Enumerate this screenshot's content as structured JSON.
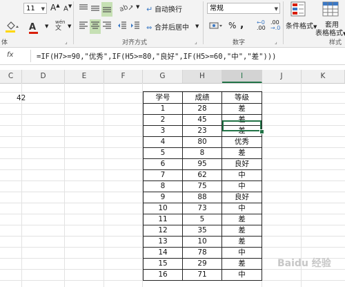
{
  "ribbon": {
    "font_size": "11",
    "font_inc": "A",
    "font_dec": "A",
    "font_color_letter": "A",
    "phonetic": "wén",
    "phonetic_sub": "文",
    "wrap_text": "自动换行",
    "merge_center": "合并后居中",
    "number_format": "常规",
    "percent": "%",
    "comma": ",",
    "dec_inc": ".00",
    "dec_dec": ".00",
    "cond_format": "条件格式",
    "format_as_table_line1": "套用",
    "format_as_table_line2": "表格格式",
    "group_font_partial": "体",
    "group_alignment": "对齐方式",
    "group_number": "数字",
    "group_styles": "样式"
  },
  "formula_bar": {
    "fx": "fx",
    "formula": "=IF(H7>=90,\"优秀\",IF(H5>=80,\"良好\",IF(H5>=60,\"中\",\"差\")))"
  },
  "columns": [
    "C",
    "D",
    "E",
    "F",
    "G",
    "H",
    "I",
    "J",
    "K"
  ],
  "cell_C": "42",
  "table": {
    "headers": [
      "学号",
      "成绩",
      "等级"
    ],
    "rows": [
      [
        "1",
        "28",
        "差"
      ],
      [
        "2",
        "45",
        "差"
      ],
      [
        "3",
        "23",
        "差"
      ],
      [
        "4",
        "80",
        "优秀"
      ],
      [
        "5",
        "8",
        "差"
      ],
      [
        "6",
        "95",
        "良好"
      ],
      [
        "7",
        "62",
        "中"
      ],
      [
        "8",
        "75",
        "中"
      ],
      [
        "9",
        "88",
        "良好"
      ],
      [
        "10",
        "73",
        "中"
      ],
      [
        "11",
        "5",
        "差"
      ],
      [
        "12",
        "35",
        "差"
      ],
      [
        "13",
        "10",
        "差"
      ],
      [
        "14",
        "78",
        "中"
      ],
      [
        "15",
        "29",
        "差"
      ],
      [
        "16",
        "71",
        "中"
      ]
    ]
  },
  "watermark": "Baidu 经验",
  "colors": {
    "accent": "#217346",
    "font_red": "#d81e06",
    "highlight_yellow": "#ffd700"
  }
}
